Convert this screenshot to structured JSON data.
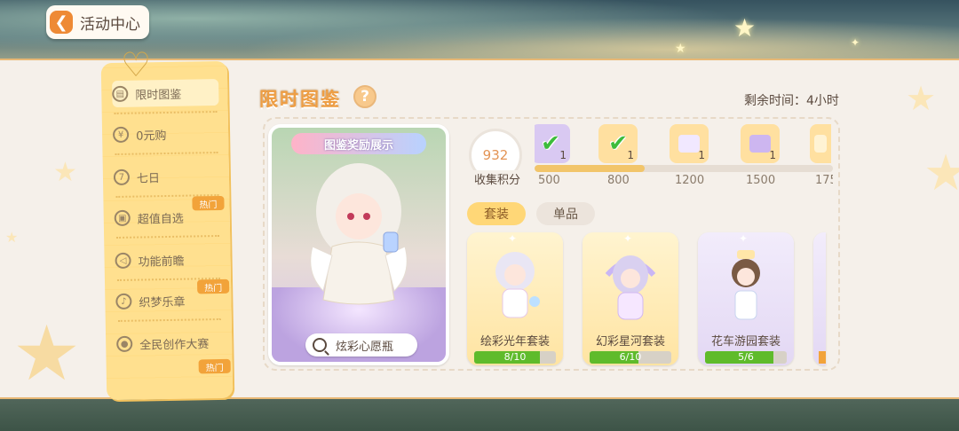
{
  "header": {
    "back_label": "活动中心"
  },
  "side_menu": {
    "items": [
      {
        "label": "限时图鉴",
        "icon": "book-icon",
        "hot": false
      },
      {
        "label": "0元购",
        "icon": "zero-coin-icon",
        "hot": false
      },
      {
        "label": "七日",
        "icon": "seven-day-icon",
        "hot": false
      },
      {
        "label": "超值自选",
        "icon": "gift-box-icon",
        "hot": true
      },
      {
        "label": "功能前瞻",
        "icon": "megaphone-icon",
        "hot": false
      },
      {
        "label": "织梦乐章",
        "icon": "music-note-icon",
        "hot": true
      },
      {
        "label": "全民创作大赛",
        "icon": "palette-icon",
        "hot": true
      }
    ],
    "hot_label": "热门"
  },
  "page": {
    "title": "限时图鉴",
    "help": "?",
    "remaining_time": "剩余时间：4小时"
  },
  "showcase": {
    "banner": "图鉴奖励展示",
    "button_label": "炫彩心愿瓶"
  },
  "score": {
    "value": "932",
    "label": "收集积分"
  },
  "rewards": {
    "progress": 0.37,
    "items": [
      {
        "milestone": "500",
        "claimed": true,
        "count": "1",
        "color": "#d9c9f2"
      },
      {
        "milestone": "800",
        "claimed": true,
        "count": "1",
        "color": "#ffe0a0"
      },
      {
        "milestone": "1200",
        "claimed": false,
        "count": "1",
        "color": "#ffe0a0"
      },
      {
        "milestone": "1500",
        "claimed": false,
        "count": "1",
        "color": "#ffe0a0"
      },
      {
        "milestone": "175",
        "claimed": false,
        "count": "",
        "color": "#ffe0a0"
      }
    ]
  },
  "tabs": [
    {
      "label": "套装",
      "active": true
    },
    {
      "label": "单品",
      "active": false
    }
  ],
  "outfits": [
    {
      "name": "绘彩光年套装",
      "progress_text": "8/10",
      "progress": 0.8,
      "theme": "yellow"
    },
    {
      "name": "幻彩星河套装",
      "progress_text": "6/10",
      "progress": 0.6,
      "theme": "yellow"
    },
    {
      "name": "花车游园套装",
      "progress_text": "5/6",
      "progress": 0.833,
      "theme": "purple"
    }
  ],
  "colors": {
    "accent_orange": "#ee9e44",
    "menu_yellow": "#ffe08f",
    "progress_green": "#5fbb2b"
  }
}
